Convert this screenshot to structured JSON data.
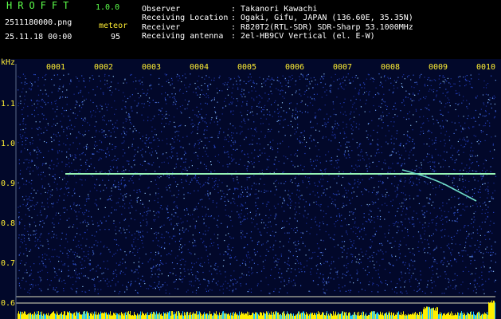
{
  "header": {
    "logo": "HROFFT",
    "version": "1.0.0",
    "filename": "2511180000.png",
    "datetime": "25.11.18 00:00",
    "meteor_label": "meteor",
    "meteor_count": "95",
    "observer_label": "Observer",
    "observer_value": ": Takanori Kawachi",
    "location_label": "Receiving Location",
    "location_value": ": Ogaki, Gifu, JAPAN (136.60E, 35.35N)",
    "receiver_label": "Receiver",
    "receiver_value": ": R820T2(RTL-SDR) SDR-Sharp 53.1000MHz",
    "antenna_label": "Receiving antenna",
    "antenna_value": ": 2el-HB9CV Vertical (el. E-W)"
  },
  "axis": {
    "unit": "kHz",
    "y_ticks": [
      "1.1",
      "1.0",
      "0.9",
      "0.8",
      "0.7",
      "0.6"
    ],
    "x_ticks": [
      "0001",
      "0002",
      "0003",
      "0004",
      "0005",
      "0006",
      "0007",
      "0008",
      "0009",
      "0010"
    ]
  },
  "colors": {
    "background": "#02082a",
    "carrier": "#7cf0c0",
    "text_yellow": "#ffee33",
    "text_green": "#5cff4a"
  }
}
